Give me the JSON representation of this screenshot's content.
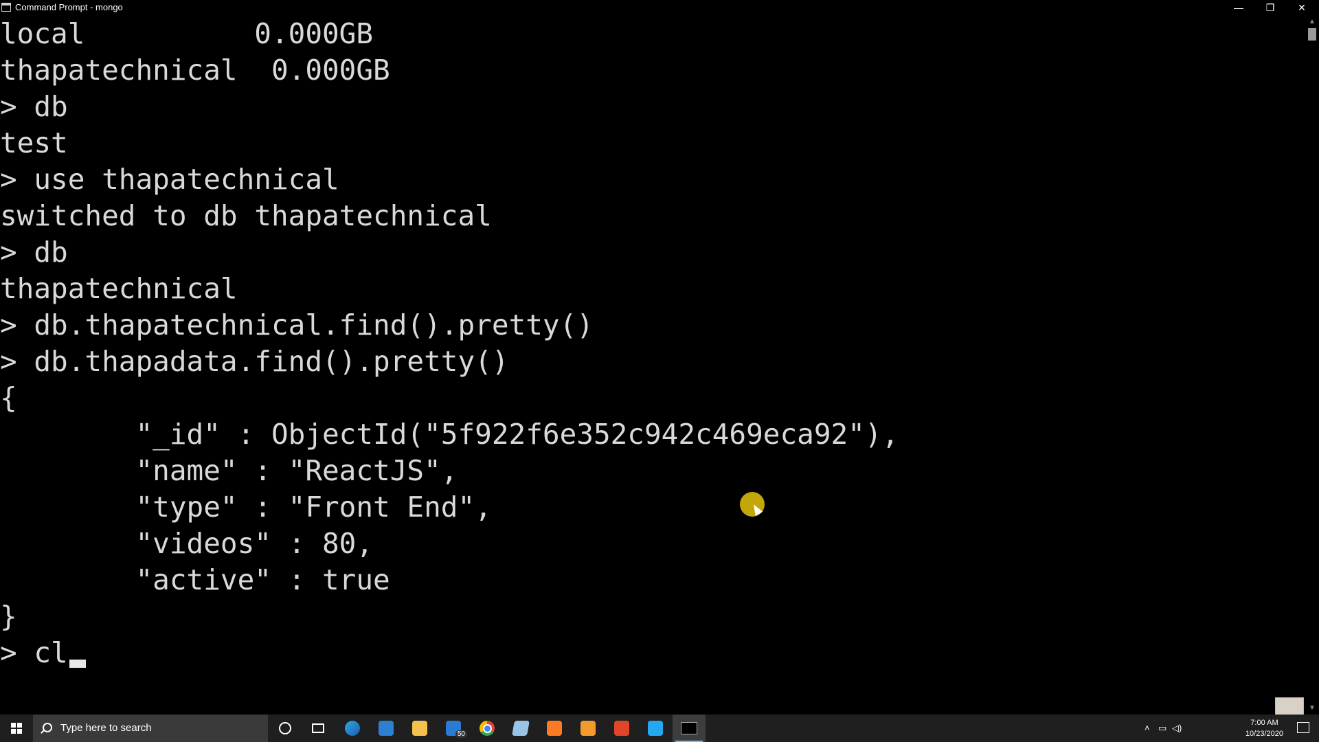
{
  "window": {
    "title": "Command Prompt - mongo",
    "buttons": {
      "minimize": "—",
      "restore": "❐",
      "close": "✕"
    }
  },
  "console": {
    "lines": [
      "local          0.000GB",
      "thapatechnical  0.000GB",
      "> db",
      "test",
      "> use thapatechnical",
      "switched to db thapatechnical",
      "> db",
      "thapatechnical",
      "> db.thapatechnical.find().pretty()",
      "> db.thapadata.find().pretty()",
      "{",
      "        \"_id\" : ObjectId(\"5f922f6e352c942c469eca92\"),",
      "        \"name\" : \"ReactJS\",",
      "        \"type\" : \"Front End\",",
      "        \"videos\" : 80,",
      "        \"active\" : true",
      "}",
      "> cl"
    ]
  },
  "taskbar": {
    "search_placeholder": "Type here to search",
    "mail_badge": "50",
    "apps": [
      "cortana",
      "task-view",
      "edge",
      "store",
      "file-explorer",
      "mail",
      "chrome",
      "notepad",
      "xampp",
      "sublime-text",
      "office",
      "vscode",
      "command-prompt"
    ],
    "clock_time": "7:00 AM",
    "clock_date": "10/23/2020"
  }
}
